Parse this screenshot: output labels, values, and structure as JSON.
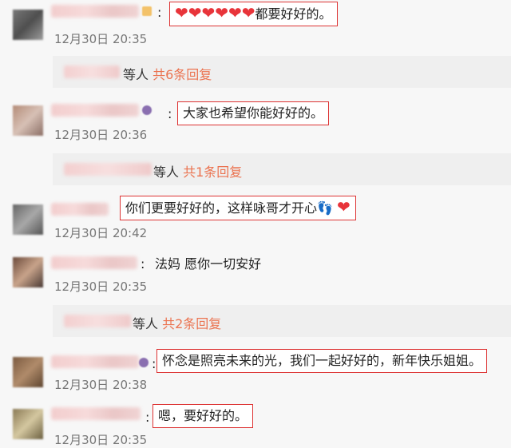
{
  "comments": [
    {
      "text_suffix": "都要好好的。",
      "hearts": "❤❤❤❤❤❤",
      "time": "12月30日 20:35"
    },
    {
      "text": "大家也希望你能好好的。",
      "time": "12月30日 20:36"
    },
    {
      "text": "你们更要好好的，这样咏哥才开心",
      "emoji": "👣",
      "heart": "❤",
      "time": "12月30日 20:42"
    },
    {
      "text": "法妈 愿你一切安好",
      "time": "12月30日 20:35"
    },
    {
      "text": "怀念是照亮未来的光，我们一起好好的，新年快乐姐姐。",
      "time": "12月30日 20:38"
    },
    {
      "text": "嗯，要好好的。",
      "time": "12月30日 20:35"
    }
  ],
  "replies": [
    {
      "prefix": "等人",
      "count": "共6条回复"
    },
    {
      "prefix": "等人",
      "count": "共1条回复"
    },
    {
      "prefix": "等人",
      "count": "共2条回复"
    }
  ],
  "colors": {
    "highlight_border": "#dd3333",
    "reply_accent": "#eb7350",
    "heart": "#e8343a"
  },
  "icons": [
    "avatar-blurred",
    "heart-icon",
    "footprint-emoji",
    "vip-badge-icon"
  ]
}
